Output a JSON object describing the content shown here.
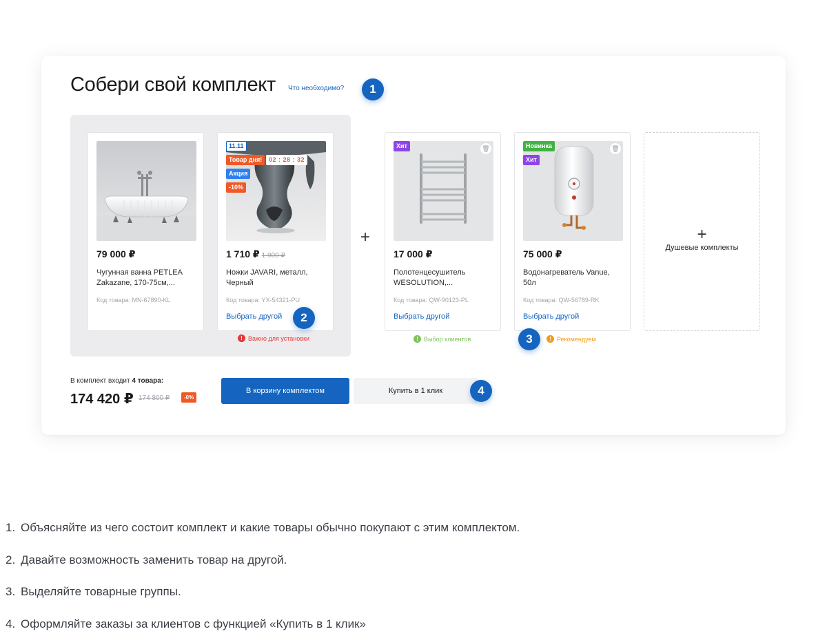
{
  "panel": {
    "title": "Собери свой комплект",
    "help_link": "Что необходимо?",
    "plus": "+",
    "required_items": [
      {
        "price": "79 000 ₽",
        "old_price": "",
        "name": "Чугунная ванна PETLEA Zakazane, 170-75см,...",
        "code": "Код товара: MN-67890-KL"
      },
      {
        "price": "1 710 ₽",
        "old_price": "1 900 ₽",
        "name": "Ножки JAVARI, металл, Черный",
        "code": "Код товара: YX-54321-PU",
        "choose": "Выбрать другой",
        "badges": {
          "date": "11.11",
          "day": "Товар дня!",
          "timer": "02 : 28 : 32",
          "sale": "Акция",
          "discount": "-10%"
        }
      }
    ],
    "required_note": "Важно для установки",
    "optional_items": [
      {
        "price": "17 000 ₽",
        "name": "Полотенцесушитель WESOLUTION,...",
        "code": "Код товара: QW-90123-PL",
        "choose": "Выбрать другой",
        "badges": {
          "hit": "Хит"
        },
        "note": "Выбор клиентов"
      },
      {
        "price": "75 000 ₽",
        "name": "Водонагреватель Vanue, 50л",
        "code": "Код товара: QW-56789-RK",
        "choose": "Выбрать другой",
        "badges": {
          "new": "Новинка",
          "hit": "Хит"
        },
        "note": "Рекомендуем"
      }
    ],
    "add_card": {
      "plus": "+",
      "label": "Душевые комплекты"
    },
    "summary": {
      "label_prefix": "В комплект входит ",
      "label_count": "4 товара:",
      "total": "174 420 ₽",
      "old_total": "174 800 ₽",
      "discount": "-0%"
    },
    "buttons": {
      "cart": "В корзину комплектом",
      "one_click": "Купить в 1 клик"
    }
  },
  "markers": [
    "1",
    "2",
    "3",
    "4"
  ],
  "notes": [
    {
      "num": "1.",
      "text": "Объясняйте из чего состоит комплект и какие товары обычно покупают с этим комплектом."
    },
    {
      "num": "2.",
      "text": "Давайте возможность заменить товар на другой."
    },
    {
      "num": "3.",
      "text": "Выделяйте товарные группы."
    },
    {
      "num": "4.",
      "text": "Оформляйте заказы за клиентов с функцией «Купить в 1 клик»"
    }
  ],
  "colors": {
    "accent": "#1565c0",
    "sale": "#f05a28",
    "hit": "#8e44e8",
    "new": "#43b244",
    "required_note": "#e53935",
    "choice_note": "#7cc35a",
    "recommend_note": "#f39c12"
  },
  "icons": [
    "trash-icon",
    "alert-icon",
    "plus-icon"
  ]
}
